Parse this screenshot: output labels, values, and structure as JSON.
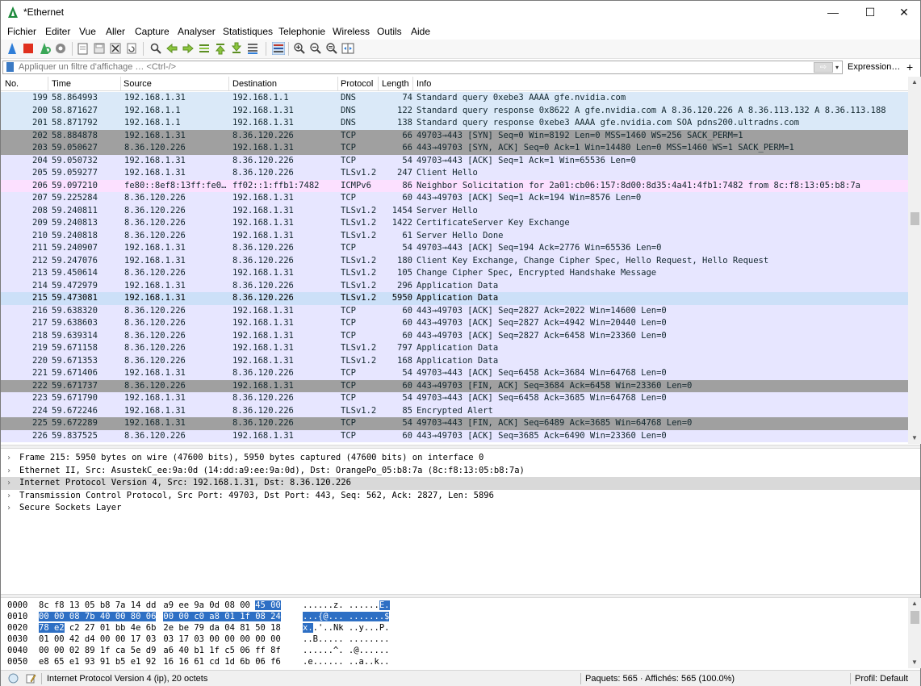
{
  "window": {
    "title": "*Ethernet",
    "minimize": "—",
    "maximize": "☐",
    "close": "✕"
  },
  "menu": [
    "Fichier",
    "Editer",
    "Vue",
    "Aller",
    "Capture",
    "Analyser",
    "Statistiques",
    "Telephonie",
    "Wireless",
    "Outils",
    "Aide"
  ],
  "filter": {
    "placeholder": "Appliquer un filtre d'affichage … <Ctrl-/>",
    "apply": "⇨",
    "dropdown": "▾",
    "expression": "Expression…",
    "add": "+"
  },
  "packet_list": {
    "columns": [
      "No.",
      "Time",
      "Source",
      "Destination",
      "Protocol",
      "Length",
      "Info"
    ],
    "rows": [
      {
        "no": "199",
        "time": "58.864993",
        "src": "192.168.1.31",
        "dst": "192.168.1.1",
        "proto": "DNS",
        "len": "74",
        "info": "Standard query 0xebe3 AAAA gfe.nvidia.com",
        "bg": "#dae9f8",
        "fg": "#12272e"
      },
      {
        "no": "200",
        "time": "58.871627",
        "src": "192.168.1.1",
        "dst": "192.168.1.31",
        "proto": "DNS",
        "len": "122",
        "info": "Standard query response 0x8622 A gfe.nvidia.com A 8.36.120.226 A 8.36.113.132 A 8.36.113.188",
        "bg": "#dae9f8",
        "fg": "#12272e"
      },
      {
        "no": "201",
        "time": "58.871792",
        "src": "192.168.1.1",
        "dst": "192.168.1.31",
        "proto": "DNS",
        "len": "138",
        "info": "Standard query response 0xebe3 AAAA gfe.nvidia.com SOA pdns200.ultradns.com",
        "bg": "#dae9f8",
        "fg": "#12272e"
      },
      {
        "no": "202",
        "time": "58.884878",
        "src": "192.168.1.31",
        "dst": "8.36.120.226",
        "proto": "TCP",
        "len": "66",
        "info": "49703→443 [SYN] Seq=0 Win=8192 Len=0 MSS=1460 WS=256 SACK_PERM=1",
        "bg": "#a0a0a0",
        "fg": "#12272e"
      },
      {
        "no": "203",
        "time": "59.050627",
        "src": "8.36.120.226",
        "dst": "192.168.1.31",
        "proto": "TCP",
        "len": "66",
        "info": "443→49703 [SYN, ACK] Seq=0 Ack=1 Win=14480 Len=0 MSS=1460 WS=1 SACK_PERM=1",
        "bg": "#a0a0a0",
        "fg": "#12272e"
      },
      {
        "no": "204",
        "time": "59.050732",
        "src": "192.168.1.31",
        "dst": "8.36.120.226",
        "proto": "TCP",
        "len": "54",
        "info": "49703→443 [ACK] Seq=1 Ack=1 Win=65536 Len=0",
        "bg": "#e7e6ff",
        "fg": "#12272e"
      },
      {
        "no": "205",
        "time": "59.059277",
        "src": "192.168.1.31",
        "dst": "8.36.120.226",
        "proto": "TLSv1.2",
        "len": "247",
        "info": "Client Hello",
        "bg": "#e7e6ff",
        "fg": "#12272e"
      },
      {
        "no": "206",
        "time": "59.097210",
        "src": "fe80::8ef8:13ff:fe0…",
        "dst": "ff02::1:ffb1:7482",
        "proto": "ICMPv6",
        "len": "86",
        "info": "Neighbor Solicitation for 2a01:cb06:157:8d00:8d35:4a41:4fb1:7482 from 8c:f8:13:05:b8:7a",
        "bg": "#fce0ff",
        "fg": "#12272e"
      },
      {
        "no": "207",
        "time": "59.225284",
        "src": "8.36.120.226",
        "dst": "192.168.1.31",
        "proto": "TCP",
        "len": "60",
        "info": "443→49703 [ACK] Seq=1 Ack=194 Win=8576 Len=0",
        "bg": "#e7e6ff",
        "fg": "#12272e"
      },
      {
        "no": "208",
        "time": "59.240811",
        "src": "8.36.120.226",
        "dst": "192.168.1.31",
        "proto": "TLSv1.2",
        "len": "1454",
        "info": "Server Hello",
        "bg": "#e7e6ff",
        "fg": "#12272e"
      },
      {
        "no": "209",
        "time": "59.240813",
        "src": "8.36.120.226",
        "dst": "192.168.1.31",
        "proto": "TLSv1.2",
        "len": "1422",
        "info": "CertificateServer Key Exchange",
        "bg": "#e7e6ff",
        "fg": "#12272e"
      },
      {
        "no": "210",
        "time": "59.240818",
        "src": "8.36.120.226",
        "dst": "192.168.1.31",
        "proto": "TLSv1.2",
        "len": "61",
        "info": "Server Hello Done",
        "bg": "#e7e6ff",
        "fg": "#12272e"
      },
      {
        "no": "211",
        "time": "59.240907",
        "src": "192.168.1.31",
        "dst": "8.36.120.226",
        "proto": "TCP",
        "len": "54",
        "info": "49703→443 [ACK] Seq=194 Ack=2776 Win=65536 Len=0",
        "bg": "#e7e6ff",
        "fg": "#12272e"
      },
      {
        "no": "212",
        "time": "59.247076",
        "src": "192.168.1.31",
        "dst": "8.36.120.226",
        "proto": "TLSv1.2",
        "len": "180",
        "info": "Client Key Exchange, Change Cipher Spec, Hello Request, Hello Request",
        "bg": "#e7e6ff",
        "fg": "#12272e"
      },
      {
        "no": "213",
        "time": "59.450614",
        "src": "8.36.120.226",
        "dst": "192.168.1.31",
        "proto": "TLSv1.2",
        "len": "105",
        "info": "Change Cipher Spec, Encrypted Handshake Message",
        "bg": "#e7e6ff",
        "fg": "#12272e"
      },
      {
        "no": "214",
        "time": "59.472979",
        "src": "192.168.1.31",
        "dst": "8.36.120.226",
        "proto": "TLSv1.2",
        "len": "296",
        "info": "Application Data",
        "bg": "#e7e6ff",
        "fg": "#12272e"
      },
      {
        "no": "215",
        "time": "59.473081",
        "src": "192.168.1.31",
        "dst": "8.36.120.226",
        "proto": "TLSv1.2",
        "len": "5950",
        "info": "Application Data",
        "bg": "#cce0f8",
        "fg": "#000000"
      },
      {
        "no": "216",
        "time": "59.638320",
        "src": "8.36.120.226",
        "dst": "192.168.1.31",
        "proto": "TCP",
        "len": "60",
        "info": "443→49703 [ACK] Seq=2827 Ack=2022 Win=14600 Len=0",
        "bg": "#e7e6ff",
        "fg": "#12272e"
      },
      {
        "no": "217",
        "time": "59.638603",
        "src": "8.36.120.226",
        "dst": "192.168.1.31",
        "proto": "TCP",
        "len": "60",
        "info": "443→49703 [ACK] Seq=2827 Ack=4942 Win=20440 Len=0",
        "bg": "#e7e6ff",
        "fg": "#12272e"
      },
      {
        "no": "218",
        "time": "59.639314",
        "src": "8.36.120.226",
        "dst": "192.168.1.31",
        "proto": "TCP",
        "len": "60",
        "info": "443→49703 [ACK] Seq=2827 Ack=6458 Win=23360 Len=0",
        "bg": "#e7e6ff",
        "fg": "#12272e"
      },
      {
        "no": "219",
        "time": "59.671158",
        "src": "8.36.120.226",
        "dst": "192.168.1.31",
        "proto": "TLSv1.2",
        "len": "797",
        "info": "Application Data",
        "bg": "#e7e6ff",
        "fg": "#12272e"
      },
      {
        "no": "220",
        "time": "59.671353",
        "src": "8.36.120.226",
        "dst": "192.168.1.31",
        "proto": "TLSv1.2",
        "len": "168",
        "info": "Application Data",
        "bg": "#e7e6ff",
        "fg": "#12272e"
      },
      {
        "no": "221",
        "time": "59.671406",
        "src": "192.168.1.31",
        "dst": "8.36.120.226",
        "proto": "TCP",
        "len": "54",
        "info": "49703→443 [ACK] Seq=6458 Ack=3684 Win=64768 Len=0",
        "bg": "#e7e6ff",
        "fg": "#12272e"
      },
      {
        "no": "222",
        "time": "59.671737",
        "src": "8.36.120.226",
        "dst": "192.168.1.31",
        "proto": "TCP",
        "len": "60",
        "info": "443→49703 [FIN, ACK] Seq=3684 Ack=6458 Win=23360 Len=0",
        "bg": "#a0a0a0",
        "fg": "#12272e"
      },
      {
        "no": "223",
        "time": "59.671790",
        "src": "192.168.1.31",
        "dst": "8.36.120.226",
        "proto": "TCP",
        "len": "54",
        "info": "49703→443 [ACK] Seq=6458 Ack=3685 Win=64768 Len=0",
        "bg": "#e7e6ff",
        "fg": "#12272e"
      },
      {
        "no": "224",
        "time": "59.672246",
        "src": "192.168.1.31",
        "dst": "8.36.120.226",
        "proto": "TLSv1.2",
        "len": "85",
        "info": "Encrypted Alert",
        "bg": "#e7e6ff",
        "fg": "#12272e"
      },
      {
        "no": "225",
        "time": "59.672289",
        "src": "192.168.1.31",
        "dst": "8.36.120.226",
        "proto": "TCP",
        "len": "54",
        "info": "49703→443 [FIN, ACK] Seq=6489 Ack=3685 Win=64768 Len=0",
        "bg": "#a0a0a0",
        "fg": "#12272e"
      },
      {
        "no": "226",
        "time": "59.837525",
        "src": "8.36.120.226",
        "dst": "192.168.1.31",
        "proto": "TCP",
        "len": "60",
        "info": "443→49703 [ACK] Seq=3685 Ack=6490 Win=23360 Len=0",
        "bg": "#e7e6ff",
        "fg": "#12272e"
      }
    ]
  },
  "details": [
    {
      "chev": "›",
      "text": "Frame 215: 5950 bytes on wire (47600 bits), 5950 bytes captured (47600 bits) on interface 0",
      "selected": false
    },
    {
      "chev": "›",
      "text": "Ethernet II, Src: AsustekC_ee:9a:0d (14:dd:a9:ee:9a:0d), Dst: OrangePo_05:b8:7a (8c:f8:13:05:b8:7a)",
      "selected": false
    },
    {
      "chev": "›",
      "text": "Internet Protocol Version 4, Src: 192.168.1.31, Dst: 8.36.120.226",
      "selected": true
    },
    {
      "chev": "›",
      "text": "Transmission Control Protocol, Src Port: 49703, Dst Port: 443, Seq: 562, Ack: 2827, Len: 5896",
      "selected": false
    },
    {
      "chev": "›",
      "text": "Secure Sockets Layer",
      "selected": false
    }
  ],
  "bytes": [
    {
      "off": "0000",
      "hex": [
        "8c f8 13 05 b8 7a 14 dd",
        "a9 ee 9a 0d 08 00 ",
        "45 00"
      ],
      "hl_start": 2,
      "asc": [
        "......z.",
        " ......",
        "E."
      ]
    },
    {
      "off": "0010",
      "hex": [
        "00 00 08 7b 40 00 80 06",
        "00 00 c0 a8 01 1f 08 24"
      ],
      "hl_all": true,
      "asc": [
        "...{@...",
        " .......$"
      ]
    },
    {
      "off": "0020",
      "hex": [
        "78 e2",
        " c2 27 01 bb 4e 6b",
        "2e be 79 da 04 81 50 18"
      ],
      "hl_first": true,
      "asc": [
        "x.",
        ".'..Nk",
        " ..y...P."
      ]
    },
    {
      "off": "0030",
      "hex": [
        "01 00 42 d4 00 00 17 03",
        "03 17 03 00 00 00 00 00"
      ],
      "asc": [
        "..B.....",
        " ........"
      ]
    },
    {
      "off": "0040",
      "hex": [
        "00 00 02 89 1f ca 5e d9",
        "a6 40 b1 1f c5 06 ff 8f"
      ],
      "asc": [
        "......^.",
        " .@......"
      ]
    },
    {
      "off": "0050",
      "hex": [
        "e8 65 e1 93 91 b5 e1 92",
        "16 16 61 cd 1d 6b 06 f6"
      ],
      "asc": [
        ".e......",
        " ..a..k.."
      ]
    }
  ],
  "status": {
    "info": "Internet Protocol Version 4 (ip), 20 octets",
    "packets": "Paquets: 565 · Affichés: 565 (100.0%)",
    "profile": "Profil: Default"
  }
}
